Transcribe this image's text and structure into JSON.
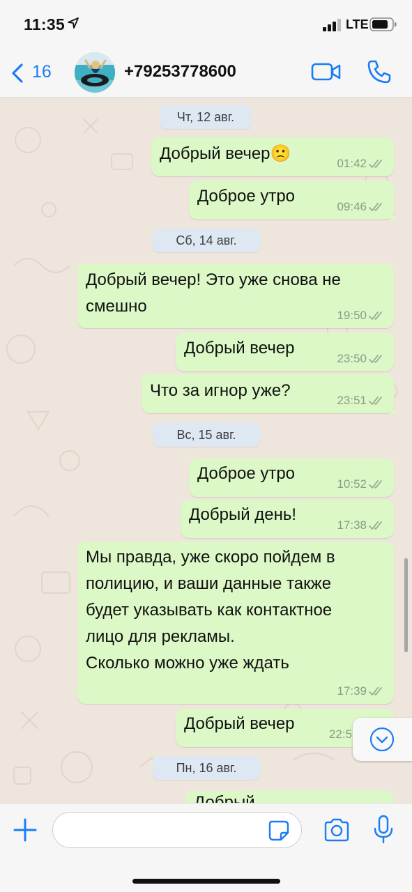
{
  "status_bar": {
    "time": "11:35",
    "network": "LTE",
    "icons": [
      "location-arrow-icon",
      "signal-icon",
      "battery-icon"
    ]
  },
  "header": {
    "back_count": "16",
    "contact": "+79253778600",
    "icons": [
      "chevron-left-icon",
      "video-call-icon",
      "phone-icon"
    ],
    "accent_color": "#1a7cf5"
  },
  "chat": {
    "dates": [
      "Чт, 12 авг.",
      "Сб, 14 авг.",
      "Вс, 15 авг.",
      "Пн, 16 авг."
    ],
    "messages": [
      {
        "text": "Добрый вечер🙁",
        "time": "01:42"
      },
      {
        "text": "Доброе утро",
        "time": "09:46"
      },
      {
        "text": "Добрый вечер! Это уже снова не\nсмешно",
        "time": "19:50"
      },
      {
        "text": "Добрый вечер",
        "time": "23:50"
      },
      {
        "text": "Что за игнор уже?",
        "time": "23:51"
      },
      {
        "text": "Доброе утро",
        "time": "10:52"
      },
      {
        "text": "Добрый день!",
        "time": "17:38"
      },
      {
        "text": "Мы правда, уже скоро пойдем в\nполицию, и ваши данные также\nбудет указывать как контактное\nлицо для рекламы.\nСколько можно уже ждать",
        "time": "17:39"
      },
      {
        "text": "Добрый вечер",
        "time": "22:5"
      },
      {
        "text": "Добрый",
        "time": ""
      }
    ],
    "bubble_color": "#dcf8c6",
    "date_chip_color": "#dde8f3"
  },
  "input": {
    "placeholder": "",
    "icons": [
      "plus-icon",
      "sticker-icon",
      "camera-icon",
      "microphone-icon"
    ]
  }
}
